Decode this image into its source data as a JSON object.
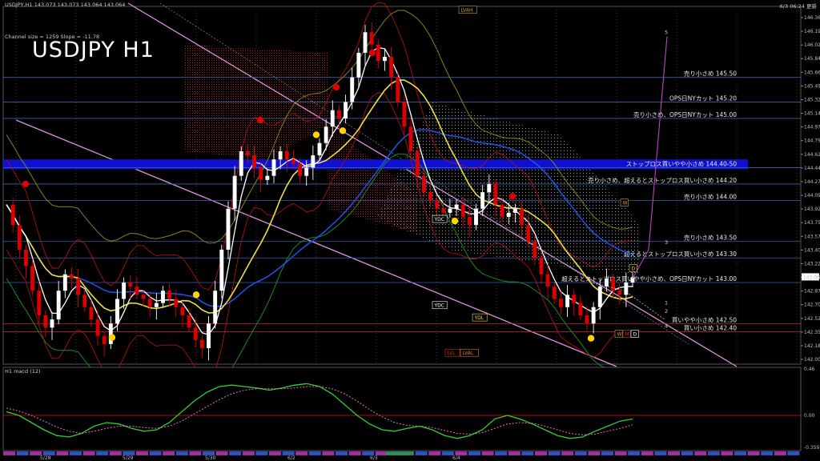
{
  "header": {
    "symbol_line": "USDJPY,H1  143.073 143.073 143.064 143.064",
    "channel_note": "Channel size = 1259   Slope = -11.78",
    "datetime": "6/3 06:24 更新",
    "big_title": "USDJPY H1"
  },
  "lower_panel": {
    "title": "H1  macd (12)",
    "levels": [
      "0.46",
      "0.00",
      "-0.359"
    ]
  },
  "colors": {
    "bull": "#ffffff",
    "bear": "#dd0000",
    "ma_fast": "#ffffff",
    "ma_mid": "#f0e040",
    "ma_slow": "#2050e0",
    "cloud": "#c01818",
    "band": "#d4d4d4",
    "chan": "#e090e0"
  },
  "chart_data": {
    "type": "candlestick",
    "ylim": [
      142.005,
      146.365
    ],
    "y_ticks": [
      "146.365",
      "146.190",
      "146.020",
      "145.840",
      "145.665",
      "145.490",
      "145.320",
      "145.145",
      "144.970",
      "144.795",
      "144.620",
      "144.445",
      "144.270",
      "144.095",
      "143.925",
      "143.750",
      "143.575",
      "143.400",
      "143.225",
      "143.050",
      "142.875",
      "142.700",
      "142.525",
      "142.350",
      "142.180",
      "142.005"
    ],
    "current_price": "143.064",
    "x_labels": [
      "5/28",
      "5/29",
      "5/30",
      "6/2",
      "6/3",
      "6/4"
    ],
    "ohlc_path": [
      143.95,
      143.7,
      143.4,
      143.2,
      142.9,
      142.6,
      142.45,
      142.55,
      142.9,
      143.1,
      143.05,
      142.85,
      142.7,
      142.55,
      142.35,
      142.25,
      142.5,
      142.8,
      143.0,
      142.95,
      142.85,
      142.8,
      142.7,
      142.75,
      142.9,
      142.8,
      142.7,
      142.6,
      142.45,
      142.3,
      142.2,
      142.5,
      142.9,
      143.4,
      143.9,
      144.3,
      144.6,
      144.55,
      144.4,
      144.25,
      144.3,
      144.5,
      144.6,
      144.5,
      144.45,
      144.3,
      144.4,
      144.55,
      144.7,
      144.9,
      145.1,
      145.0,
      145.2,
      145.5,
      145.8,
      146.05,
      145.9,
      145.7,
      145.75,
      145.5,
      145.2,
      144.9,
      144.6,
      144.3,
      144.1,
      144.0,
      143.9,
      143.85,
      143.9,
      143.95,
      143.8,
      143.7,
      143.9,
      144.1,
      144.2,
      143.95,
      143.8,
      143.85,
      143.9,
      143.7,
      143.5,
      143.3,
      143.1,
      142.95,
      142.8,
      142.7,
      142.85,
      142.75,
      142.6,
      142.5,
      142.7,
      142.95,
      143.05,
      142.9,
      142.85,
      143.0,
      143.064
    ],
    "levels": [
      {
        "price": 145.5,
        "label": "売り小さめ 145.50"
      },
      {
        "price": 145.2,
        "label": "OPS日NYカット 145.20"
      },
      {
        "price": 145.0,
        "label": "売り小さめ、OPS日NYカット 145.00"
      },
      {
        "price": 144.4,
        "label": "ストップロス買いやや小さめ 144.40-50"
      },
      {
        "price": 144.2,
        "label": "売り小さめ、超えるとストップロス買い小さめ 144.20"
      },
      {
        "price": 144.0,
        "label": "売り小さめ 144.00"
      },
      {
        "price": 143.5,
        "label": "売り小さめ 143.50"
      },
      {
        "price": 143.3,
        "label": "超えるとストップロス買い小さめ 143.30"
      },
      {
        "price": 143.0,
        "label": "超えるとストップロス買いやや小さめ、OPS日NYカット 143.00"
      },
      {
        "price": 142.5,
        "label": "買いやや小さめ 142.50"
      },
      {
        "price": 142.4,
        "label": "買い小さめ 142.40"
      }
    ],
    "wave_numbers": [
      "5",
      "3",
      "1",
      "2",
      "4"
    ],
    "tags": [
      "LVAH",
      "YDC",
      "YDC",
      "YDL",
      "LVAL",
      "LVL",
      "W",
      "M",
      "D",
      "W",
      "D"
    ],
    "macd": {
      "main": [
        0.05,
        0.0,
        -0.1,
        -0.2,
        -0.28,
        -0.3,
        -0.25,
        -0.15,
        -0.1,
        -0.12,
        -0.18,
        -0.22,
        -0.2,
        -0.1,
        0.05,
        0.2,
        0.32,
        0.4,
        0.42,
        0.4,
        0.38,
        0.35,
        0.38,
        0.42,
        0.44,
        0.4,
        0.3,
        0.15,
        0.0,
        -0.12,
        -0.2,
        -0.22,
        -0.18,
        -0.15,
        -0.2,
        -0.28,
        -0.32,
        -0.28,
        -0.2,
        -0.05,
        0.0,
        -0.05,
        -0.12,
        -0.2,
        -0.28,
        -0.32,
        -0.3,
        -0.22,
        -0.15,
        -0.08,
        -0.05
      ],
      "signal": [
        0.1,
        0.06,
        0.0,
        -0.08,
        -0.16,
        -0.22,
        -0.25,
        -0.22,
        -0.18,
        -0.15,
        -0.15,
        -0.17,
        -0.18,
        -0.15,
        -0.08,
        0.02,
        0.12,
        0.22,
        0.3,
        0.35,
        0.37,
        0.37,
        0.37,
        0.38,
        0.4,
        0.4,
        0.37,
        0.3,
        0.2,
        0.08,
        -0.02,
        -0.1,
        -0.14,
        -0.15,
        -0.17,
        -0.21,
        -0.25,
        -0.26,
        -0.24,
        -0.18,
        -0.12,
        -0.1,
        -0.11,
        -0.15,
        -0.2,
        -0.25,
        -0.27,
        -0.26,
        -0.22,
        -0.18,
        -0.13
      ]
    }
  }
}
